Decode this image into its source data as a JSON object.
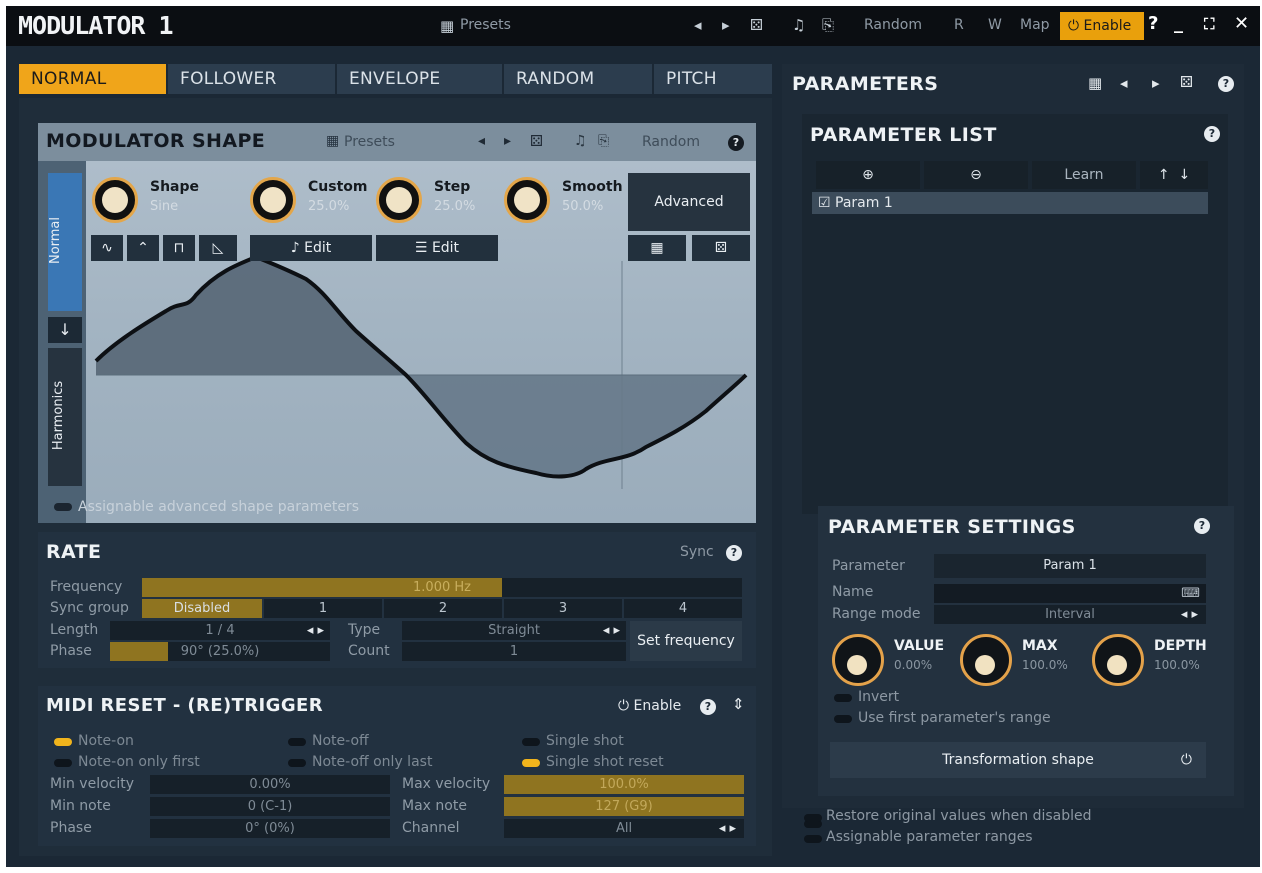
{
  "window": {
    "title": "MODULATOR 1",
    "presets": "Presets",
    "random": "Random",
    "r": "R",
    "w": "W",
    "map": "Map",
    "enable": "Enable"
  },
  "tabs": [
    "NORMAL",
    "FOLLOWER",
    "ENVELOPE",
    "RANDOM",
    "PITCH"
  ],
  "modulator_shape": {
    "title": "MODULATOR SHAPE",
    "presets": "Presets",
    "random": "Random",
    "side_tabs": [
      "Normal",
      "Harmonics"
    ],
    "knobs": [
      {
        "label": "Shape",
        "value": "Sine"
      },
      {
        "label": "Custom",
        "value": "25.0%"
      },
      {
        "label": "Step",
        "value": "25.0%"
      },
      {
        "label": "Smooth",
        "value": "50.0%"
      }
    ],
    "advanced": "Advanced",
    "edit1": "Edit",
    "edit2": "Edit",
    "assignable": "Assignable advanced shape parameters"
  },
  "rate": {
    "title": "RATE",
    "sync": "Sync",
    "frequency_label": "Frequency",
    "frequency_value": "1.000 Hz",
    "frequency_fill": 0.6,
    "sync_group_label": "Sync group",
    "sync_groups": [
      "Disabled",
      "1",
      "2",
      "3",
      "4"
    ],
    "length_label": "Length",
    "length_value": "1 / 4",
    "type_label": "Type",
    "type_value": "Straight",
    "phase_label": "Phase",
    "phase_value": "90° (25.0%)",
    "count_label": "Count",
    "count_value": "1",
    "set_frequency": "Set frequency"
  },
  "midi_reset": {
    "title": "MIDI RESET - (RE)TRIGGER",
    "enable": "Enable",
    "options": [
      {
        "label": "Note-on",
        "on": true
      },
      {
        "label": "Note-off",
        "on": false
      },
      {
        "label": "Single shot",
        "on": false
      },
      {
        "label": "Note-on only first",
        "on": false
      },
      {
        "label": "Note-off only last",
        "on": false
      },
      {
        "label": "Single shot reset",
        "on": true
      }
    ],
    "min_velocity_label": "Min velocity",
    "min_velocity": "0.00%",
    "max_velocity_label": "Max velocity",
    "max_velocity": "100.0%",
    "min_note_label": "Min note",
    "min_note": "0 (C-1)",
    "max_note_label": "Max note",
    "max_note": "127 (G9)",
    "phase_label": "Phase",
    "phase": "0° (0%)",
    "channel_label": "Channel",
    "channel": "All"
  },
  "parameters": {
    "title": "PARAMETERS",
    "list_title": "PARAMETER LIST",
    "learn": "Learn",
    "items": [
      "Param 1"
    ],
    "settings_title": "PARAMETER SETTINGS",
    "parameter_label": "Parameter",
    "parameter_value": "Param 1",
    "name_label": "Name",
    "range_mode_label": "Range mode",
    "range_mode_value": "Interval",
    "value_label": "VALUE",
    "value_value": "0.00%",
    "max_label": "MAX",
    "max_value": "100.0%",
    "depth_label": "DEPTH",
    "depth_value": "100.0%",
    "invert": "Invert",
    "use_first": "Use first parameter's range",
    "transformation": "Transformation shape",
    "restore": "Restore original values when disabled",
    "assignable_ranges": "Assignable parameter ranges"
  }
}
